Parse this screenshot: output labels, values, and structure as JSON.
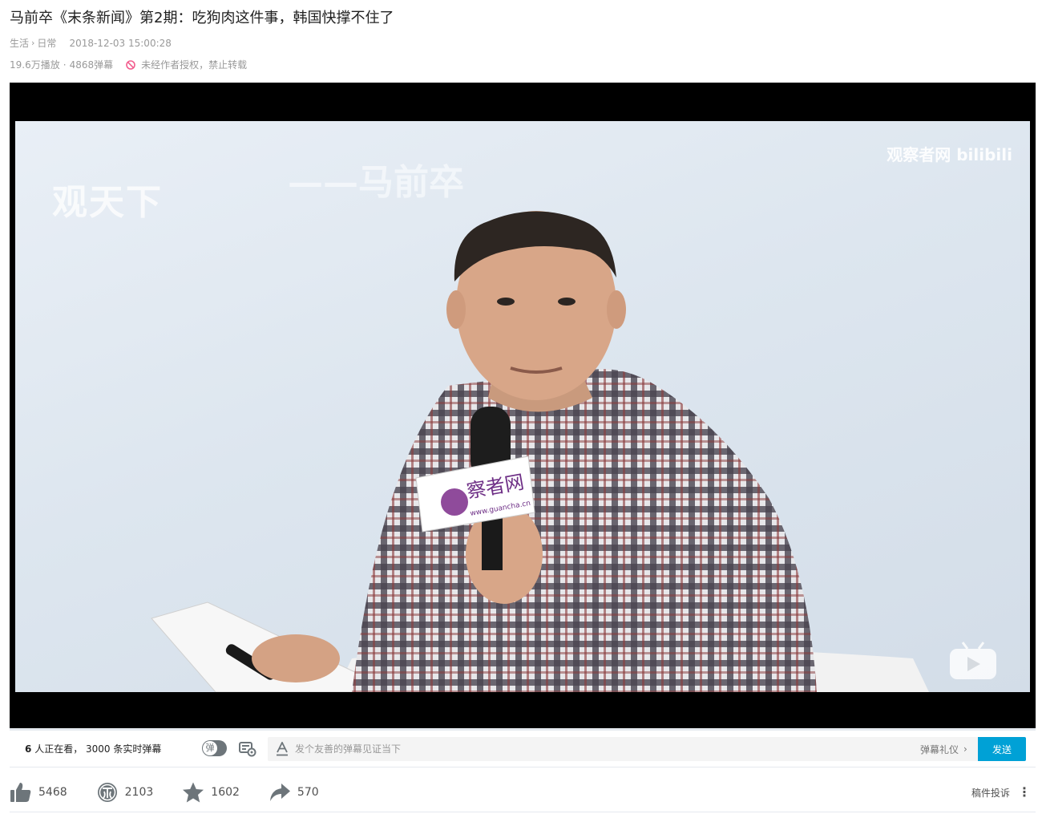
{
  "video": {
    "title": "马前卒《末条新闻》第2期：吃狗肉这件事，韩国快撑不住了",
    "breadcrumb": [
      "生活",
      "日常"
    ],
    "publish_time": "2018-12-03 15:00:28",
    "play_count": "19.6万播放",
    "danmaku_count": "4868弹幕",
    "copyright_notice": "未经作者授权，禁止转载",
    "progress_fraction": 0.0
  },
  "player": {
    "watermark_left": "观天下",
    "watermark_name": "——马前卒",
    "watermark_right": "观察者网 bilibili",
    "mic_text": "察者网",
    "mic_subtext": "www.guancha.cn"
  },
  "danmaku_bar": {
    "viewers_count": "6",
    "viewers_text": "人正在看，",
    "live_danmaku": "3000 条实时弹幕",
    "toggle_label": "弹",
    "input_placeholder": "发个友善的弹幕见证当下",
    "etiquette_label": "弹幕礼仪",
    "send_label": "发送"
  },
  "toolbar": {
    "like_count": "5468",
    "coin_count": "2103",
    "favorite_count": "1602",
    "share_count": "570",
    "report_label": "稿件投诉",
    "more_label": "⋮"
  },
  "colors": {
    "accent": "#00a1d6",
    "icon_gray": "#6d757a",
    "meta_gray": "#999999",
    "warn_red": "#f25d8e"
  }
}
